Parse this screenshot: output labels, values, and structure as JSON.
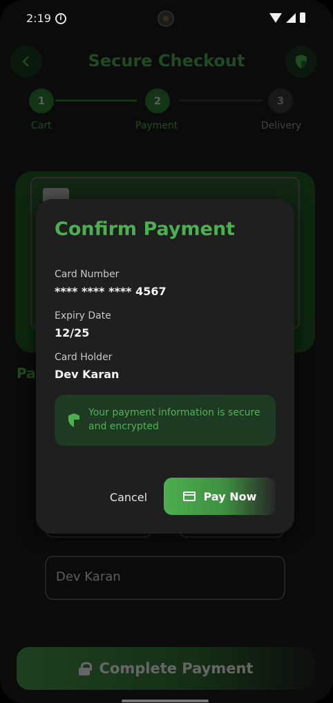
{
  "status_bar": {
    "time": "2:19"
  },
  "app": {
    "title": "Secure Checkout",
    "steps": [
      {
        "number": "1",
        "label": "Cart",
        "state": "done"
      },
      {
        "number": "2",
        "label": "Payment",
        "state": "active"
      },
      {
        "number": "3",
        "label": "Delivery",
        "state": "inactive"
      }
    ],
    "section_heading_partial": "Pa",
    "name_field_value": "Dev Karan",
    "complete_button_label": "Complete Payment"
  },
  "dialog": {
    "title": "Confirm Payment",
    "card_number_label": "Card Number",
    "card_number_value": "**** **** **** 4567",
    "expiry_label": "Expiry Date",
    "expiry_value": "12/25",
    "holder_label": "Card Holder",
    "holder_value": "Dev Karan",
    "security_notice": "Your payment information is secure and encrypted",
    "cancel_label": "Cancel",
    "pay_label": "Pay Now"
  },
  "colors": {
    "accent": "#4caf50",
    "dialog_bg": "#1f1f1f",
    "notice_bg": "#1f3a22"
  },
  "icons": [
    "info-icon",
    "wifi-icon",
    "signal-icon",
    "battery-icon",
    "back-arrow-icon",
    "shield-icon",
    "lock-icon",
    "credit-card-icon"
  ]
}
